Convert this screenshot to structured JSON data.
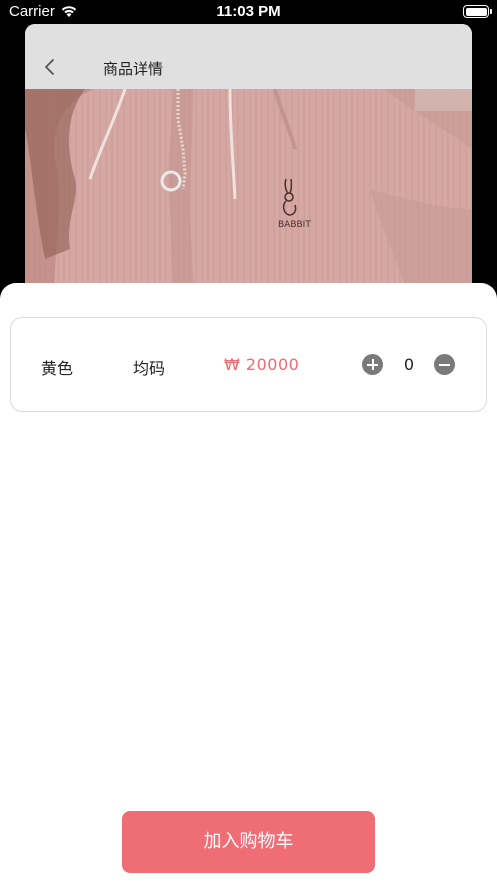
{
  "status_bar": {
    "carrier": "Carrier",
    "time": "11:03 PM",
    "battery_level": 1.0
  },
  "nav": {
    "title": "商品详情"
  },
  "product": {
    "image_icon": "photo-pink-hoodie",
    "sku": {
      "color": "黄色",
      "size": "均码",
      "price": "₩ 20000",
      "quantity": "0"
    }
  },
  "actions": {
    "add_to_cart_label": "加入购物车"
  },
  "colors": {
    "accent": "#ef6e76",
    "price_text": "#ef6a71",
    "stepper_button": "#7a7a7a"
  }
}
